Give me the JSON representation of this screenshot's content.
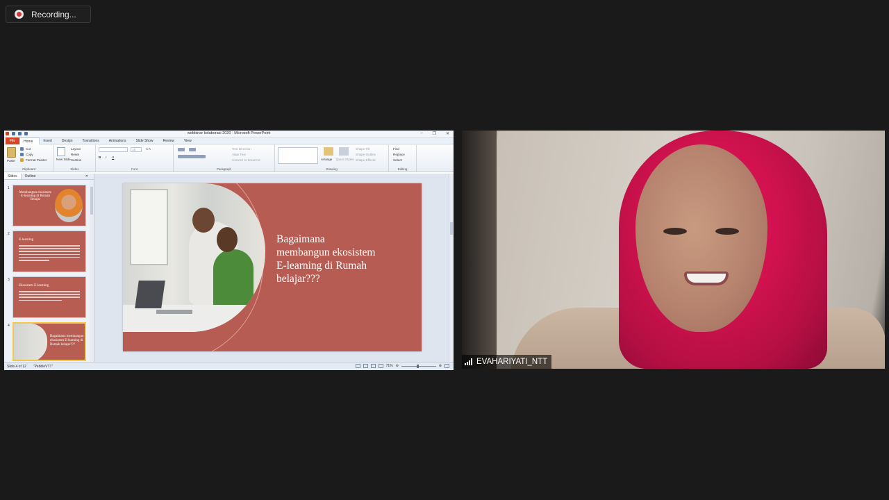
{
  "recording": {
    "label": "Recording..."
  },
  "powerpoint": {
    "window_title": "webbinar kolaborasi 2020 - Microsoft PowerPoint",
    "tabs": [
      "File",
      "Home",
      "Insert",
      "Design",
      "Transitions",
      "Animations",
      "Slide Show",
      "Review",
      "View"
    ],
    "ribbon": {
      "clipboard": {
        "paste": "Paste",
        "cut": "Cut",
        "copy": "Copy",
        "format_painter": "Format Painter",
        "label": "Clipboard"
      },
      "slides": {
        "new_slide": "New Slide",
        "layout": "Layout",
        "reset": "Reset",
        "section": "Section",
        "label": "Slides"
      },
      "font": {
        "size": "18",
        "label": "Font"
      },
      "paragraph": {
        "text_direction": "Text Direction",
        "align_text": "Align Text",
        "convert_smartart": "Convert to SmartArt",
        "label": "Paragraph"
      },
      "drawing": {
        "arrange": "Arrange",
        "quick_styles": "Quick Styles",
        "shape_fill": "Shape Fill",
        "shape_outline": "Shape Outline",
        "shape_effects": "Shape Effects",
        "label": "Drawing"
      },
      "editing": {
        "find": "Find",
        "replace": "Replace",
        "select": "Select",
        "label": "Editing"
      }
    },
    "pane_tabs": {
      "slides": "Slides",
      "outline": "Outline"
    },
    "thumbnails": [
      {
        "num": "1",
        "title": "Membangun ekosistem E-learning di Rumah Belajar"
      },
      {
        "num": "2",
        "title": "E-learning"
      },
      {
        "num": "3",
        "title": "Ekosistem E-learning"
      },
      {
        "num": "4",
        "title": "Bagaimana membangun ekosistem E-learning di Rumah belajar???"
      }
    ],
    "slide": {
      "title": "Bagaimana\nmembangun ekosistem\nE-learning di Rumah\nbelajar???"
    },
    "status": {
      "slide_counter": "Slide 4 of 12",
      "theme": "\"PebbleVTT\"",
      "zoom": "71%"
    }
  },
  "video": {
    "participant_name": "EVAHARIYATI_NTT"
  },
  "colors": {
    "slide_bg": "#b75c52",
    "hijab": "#d1124f",
    "file_tab": "#d24726"
  }
}
